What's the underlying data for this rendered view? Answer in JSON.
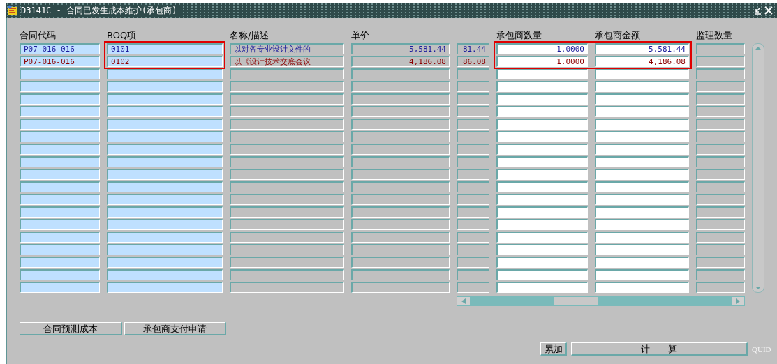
{
  "window": {
    "title": "D3141C - 合同已发生成本維护(承包商)"
  },
  "table": {
    "columns": [
      {
        "header": "合同代码",
        "kind": "key",
        "outlined": false
      },
      {
        "header": "BOQ项",
        "kind": "key",
        "outlined": true
      },
      {
        "header": "名称/描述",
        "kind": "text",
        "outlined": false
      },
      {
        "header": "单价",
        "kind": "number",
        "outlined": false
      },
      {
        "kind": "number",
        "outlined": false
      },
      {
        "header": "承包商数量",
        "kind": "input",
        "outlined": true
      },
      {
        "header": "承包商金额",
        "kind": "input",
        "outlined": true
      },
      {
        "header": "监理数量",
        "kind": "number",
        "outlined": false
      }
    ],
    "rows": [
      {
        "color": "#1c1c9c",
        "cells": [
          "P07-016-016",
          "0101",
          "以对各专业设计文件的",
          "5,581.44",
          "81.44",
          "1.0000",
          "5,581.44"
        ]
      },
      {
        "color": "#8c0000",
        "cells": [
          "P07-016-016",
          "0102",
          "以《设计技术交底会议",
          "4,186.08",
          "86.08",
          "1.0000",
          "4,186.08"
        ]
      }
    ]
  },
  "buttons": [
    "合同预测成本",
    "承包商支付申请"
  ],
  "footer": {
    "buttons": [
      "累加",
      "计　　算"
    ],
    "label": "QUID"
  }
}
